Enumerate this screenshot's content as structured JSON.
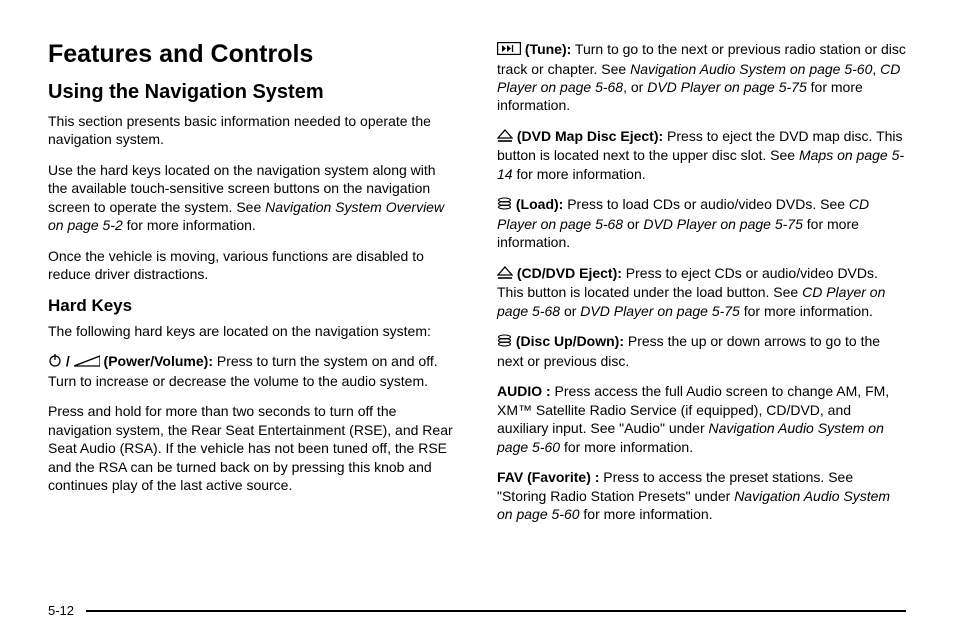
{
  "title": "Features and Controls",
  "section": {
    "heading": "Using the Navigation System",
    "intro": "This section presents basic information needed to operate the navigation system.",
    "p2a": "Use the hard keys located on the navigation system along with the available touch-sensitive screen buttons on the navigation screen to operate the system. See ",
    "p2ref": "Navigation System Overview on page 5-2",
    "p2b": " for more information.",
    "p3": "Once the vehicle is moving, various functions are disabled to reduce driver distractions."
  },
  "hardkeys": {
    "heading": "Hard Keys",
    "intro": "The following hard keys are located on the navigation system:",
    "power": {
      "label": " (Power/Volume):",
      "text": " Press to turn the system on and off. Turn to increase or decrease the volume to the audio system."
    },
    "power2": "Press and hold for more than two seconds to turn off the navigation system, the Rear Seat Entertainment (RSE), and Rear Seat Audio (RSA). If the vehicle has not been tuned off, the RSE and the RSA can be turned back on by pressing this knob and continues play of the last active source.",
    "tune": {
      "label": " (Tune):",
      "text_a": " Turn to go to the next or previous radio station or disc track or chapter. See ",
      "ref1": "Navigation Audio System on page 5-60",
      "mid1": ", ",
      "ref2": "CD Player on page 5-68",
      "mid2": ", or ",
      "ref3": "DVD Player on page 5-75",
      "text_b": " for more information."
    },
    "dvdeject": {
      "label": " (DVD Map Disc Eject):",
      "text_a": " Press to eject the DVD map disc. This button is located next to the upper disc slot. See ",
      "ref": "Maps on page 5-14",
      "text_b": " for more information."
    },
    "load": {
      "label": " (Load):",
      "text_a": " Press to load CDs or audio/video DVDs. See ",
      "ref1": "CD Player on page 5-68",
      "mid": " or ",
      "ref2": "DVD Player on page 5-75",
      "text_b": " for more information."
    },
    "cdeject": {
      "label": " (CD/DVD Eject):",
      "text_a": " Press to eject CDs or audio/video DVDs. This button is located under the load button. See ",
      "ref1": "CD Player on page 5-68",
      "mid": " or ",
      "ref2": "DVD Player on page 5-75",
      "text_b": " for more information."
    },
    "disc": {
      "label": " (Disc Up/Down):",
      "text": " Press the up or down arrows to go to the next or previous disc."
    },
    "audio": {
      "label": "AUDIO :",
      "text_a": " Press access the full Audio screen to change AM, FM, XM™ Satellite Radio Service (if equipped), CD/DVD, and auxiliary input. See \"Audio\" under ",
      "ref": "Navigation Audio System on page 5-60",
      "text_b": " for more information."
    },
    "fav": {
      "label": "FAV (Favorite) :",
      "text_a": " Press to access the preset stations. See \"Storing Radio Station Presets\" under ",
      "ref": "Navigation Audio System on page 5-60",
      "text_b": " for more information."
    }
  },
  "page_num": "5-12"
}
